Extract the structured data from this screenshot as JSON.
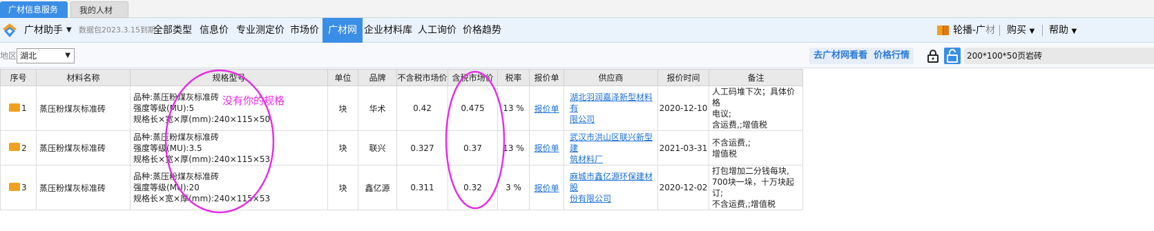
{
  "window_tabs": [
    "广材信息服务",
    "我的人材机"
  ],
  "nav": {
    "assistant": "广材助手",
    "data_pack": "数据包2023.3.15到期",
    "items": [
      "全部类型",
      "信息价",
      "专业测定价",
      "市场价",
      "广材网",
      "企业材料库",
      "人工询价",
      "价格趋势"
    ],
    "active_item": "广材网",
    "right": {
      "carousel": "轮播-广",
      "carousel_trunc": "材",
      "buy": "购买",
      "help": "帮助"
    }
  },
  "toolbar": {
    "region_label": "地区",
    "region_value": "湖北",
    "link1": "去广材网看看",
    "link2": "价格行情",
    "search_value": "200*100*50页岩砖"
  },
  "table": {
    "headers": [
      "序号",
      "材料名称",
      "规格型号",
      "单位",
      "品牌",
      "不含税市场价",
      "含税市场价",
      "税率",
      "报价单",
      "供应商",
      "报价时间",
      "备注"
    ],
    "rows": [
      {
        "idx": "1",
        "name": "蒸压粉煤灰标准砖",
        "spec": [
          "品种:蒸压粉煤灰标准砖",
          "强度等级(MU):5",
          "规格长×宽×厚(mm):240×115×50"
        ],
        "unit": "块",
        "brand": "华术",
        "price_ex_tax": "0.42",
        "price_in_tax": "0.475",
        "tax_rate": "13 %",
        "quote": "报价单",
        "supplier": [
          "湖北羽润嘉泽新型材料有",
          "限公司"
        ],
        "date": "2020-12-10",
        "note": [
          "人工码堆下次；具体价格",
          "电议;",
          "含运费,;增值税"
        ]
      },
      {
        "idx": "2",
        "name": "蒸压粉煤灰标准砖",
        "spec": [
          "品种:蒸压粉煤灰标准砖",
          "强度等级(MU):3.5",
          "规格长×宽×厚(mm):240×115×53"
        ],
        "unit": "块",
        "brand": "联兴",
        "price_ex_tax": "0.327",
        "price_in_tax": "0.37",
        "tax_rate": "13 %",
        "quote": "报价单",
        "supplier": [
          "武汉市洪山区联兴新型建",
          "筑材料厂"
        ],
        "date": "2021-03-31",
        "note": [
          "不含运费,;",
          "增值税"
        ]
      },
      {
        "idx": "3",
        "name": "蒸压粉煤灰标准砖",
        "spec": [
          "品种:蒸压粉煤灰标准砖",
          "强度等级(MU):20",
          "规格长×宽×厚(mm):240×115×53"
        ],
        "unit": "块",
        "brand": "鑫亿源",
        "price_ex_tax": "0.311",
        "price_in_tax": "0.32",
        "tax_rate": "3 %",
        "quote": "报价单",
        "supplier": [
          "麻城市鑫亿源环保建材股",
          "份有限公司"
        ],
        "date": "2020-12-02",
        "note": [
          "打包增加二分钱每块,",
          "700块一垛，十万块起订;",
          "不含运费,;增值税"
        ]
      }
    ]
  },
  "annotation": {
    "text": "没有你的规格",
    "color": "#e62ee6"
  },
  "colors": {
    "accent": "#3a8ee6",
    "link": "#1a6fd6",
    "tag": "#f0a020"
  }
}
